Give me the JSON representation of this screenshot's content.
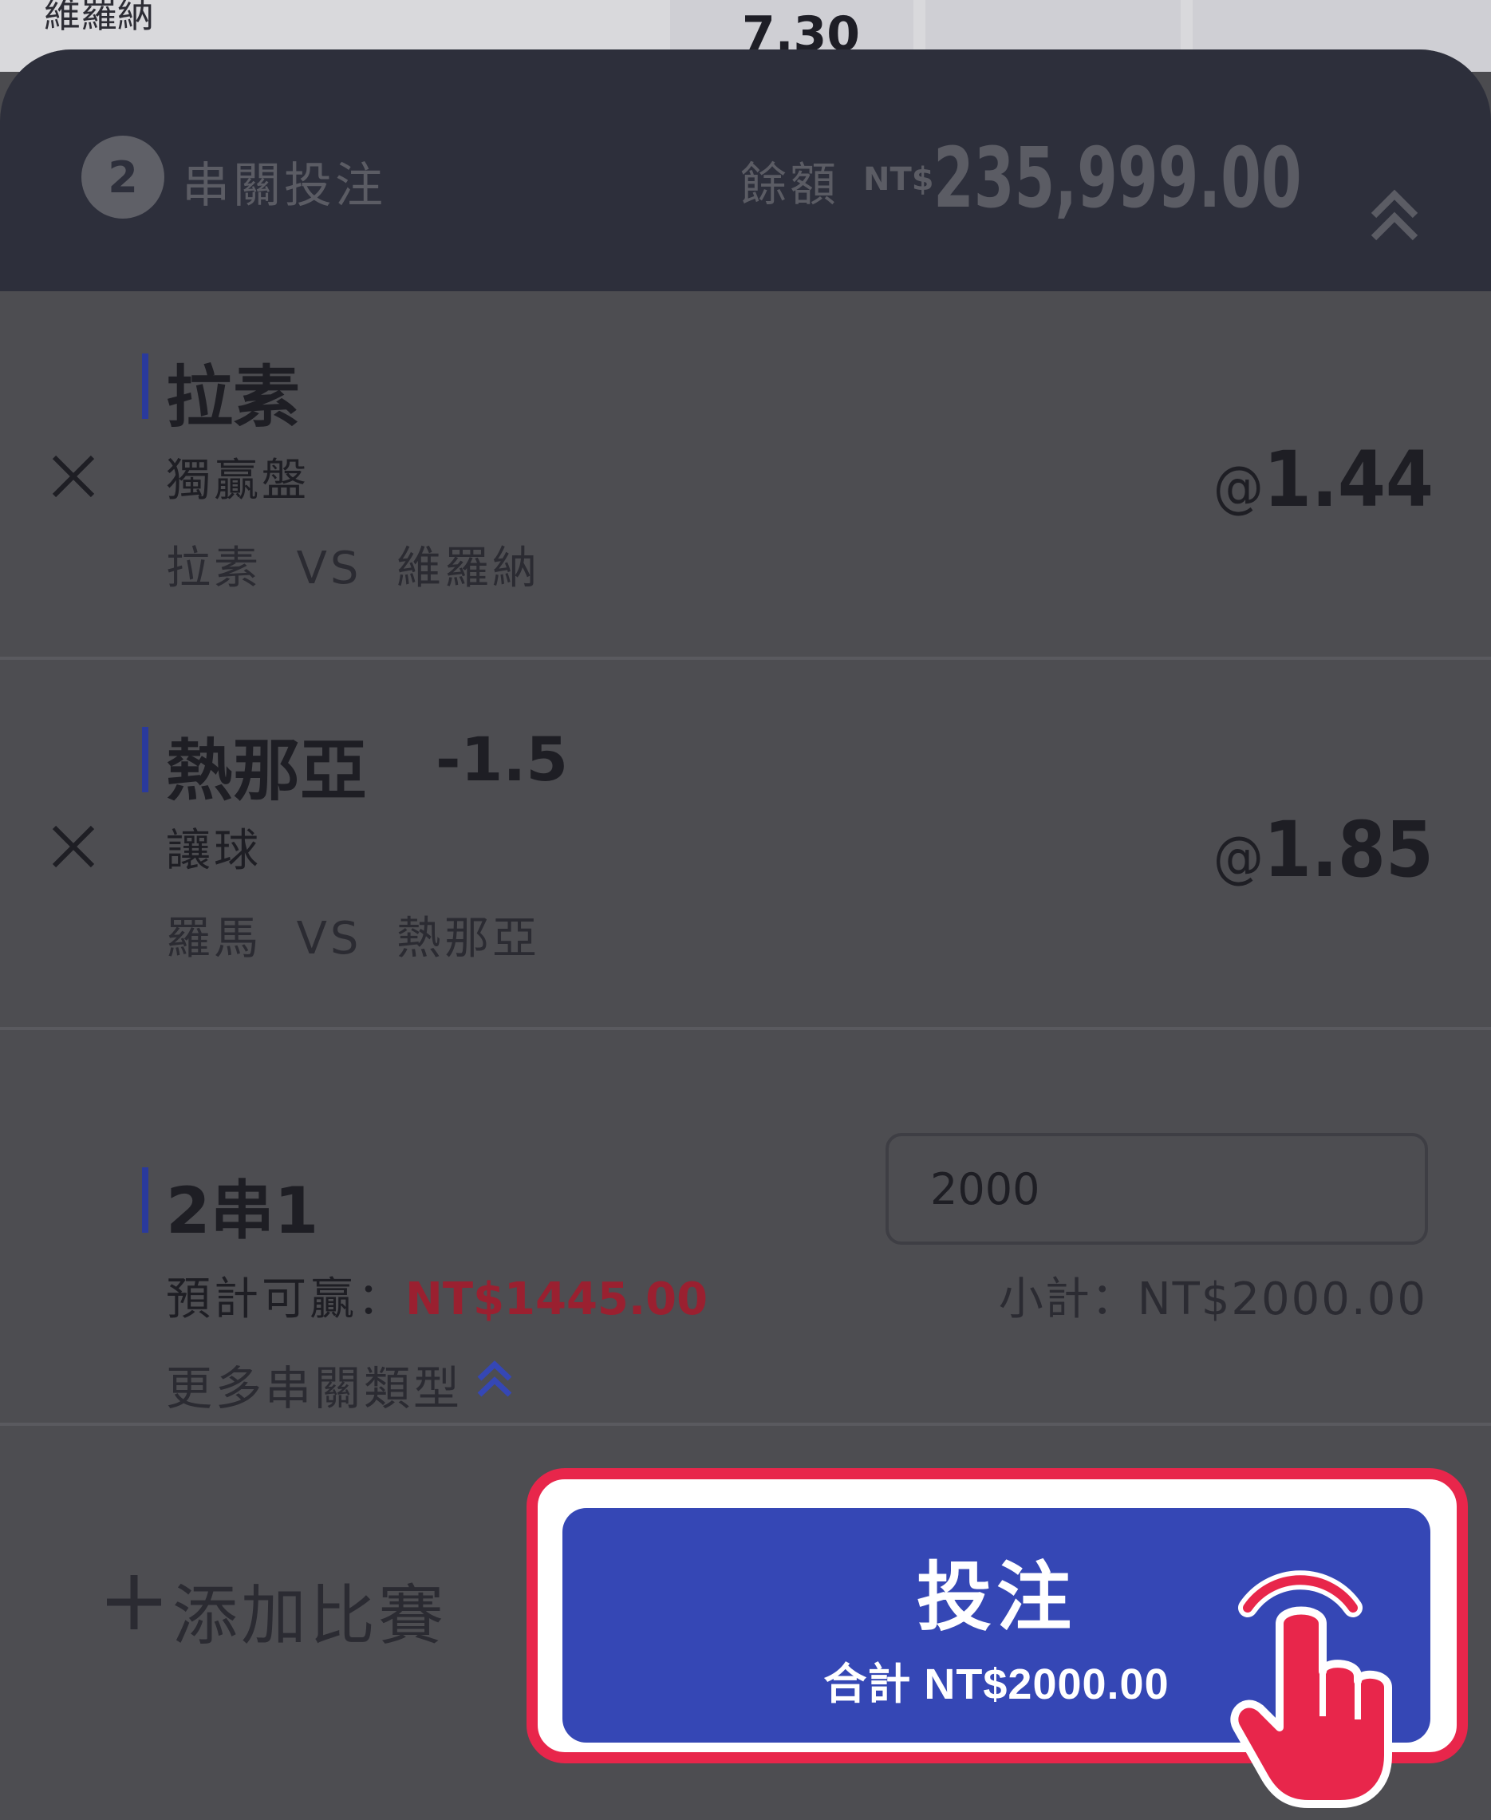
{
  "background": {
    "team": "維羅納",
    "odds": "7.30"
  },
  "header": {
    "selection_count": "2",
    "title": "串關投注",
    "balance_label": "餘額",
    "currency": "NT$",
    "balance": "235,999.00"
  },
  "selections": [
    {
      "name": "拉素",
      "handicap": "",
      "market": "獨贏盤",
      "matchup": "拉素  VS  維羅納",
      "odds": "1.44"
    },
    {
      "name": "熱那亞",
      "handicap": "-1.5",
      "market": "讓球",
      "matchup": "羅馬  VS  熱那亞",
      "odds": "1.85"
    }
  ],
  "parlay": {
    "type": "2串1",
    "stake": "2000",
    "potential_win_label": "預計可贏：",
    "potential_win": "NT$1445.00",
    "subtotal": "小計：NT$2000.00",
    "more_types": "更多串關類型"
  },
  "footer": {
    "add_match": "添加比賽",
    "place_bet_label": "投注",
    "place_bet_total": "合計 NT$2000.00"
  },
  "colors": {
    "header_bg": "#2d2f3b",
    "selection_bar": "#2a3a9c",
    "win_amount": "#9a2030",
    "bet_button": "#3547b5",
    "highlight": "#e8264b"
  }
}
